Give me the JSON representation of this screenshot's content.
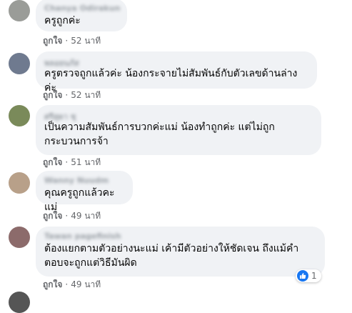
{
  "comments": [
    {
      "author": "Chanya Odirakun",
      "text": "ครูถูกค่ะ",
      "like_label": "ถูกใจ",
      "time": "52 นาที",
      "avatar_color": "#9a9c98"
    },
    {
      "author": "พลอยนภัส",
      "text": "ครูตรวจถูกแล้วค่ะ น้องกระจายไม่สัมพันธ์กับตัวเลขด้านล่างค่ะ",
      "like_label": "ถูกใจ",
      "time": "52 นาที",
      "avatar_color": "#6f7a8f"
    },
    {
      "author": "ศรีสุดา ชุ",
      "text": "เป็นความสัมพันธ์การบวกค่ะแม่ น้องทำถูกค่ะ แต่ไม่ถูก\nกระบวนการจ้า",
      "like_label": "ถูกใจ",
      "time": "51 นาที",
      "avatar_color": "#7a8a5a"
    },
    {
      "author": "Wanny Nuudm",
      "text": "คุณครูถูกแล้วคะแม่",
      "like_label": "ถูกใจ",
      "time": "49 นาที",
      "avatar_color": "#b8a089"
    },
    {
      "author": "Tawan pagefinish",
      "text": "ต้องแยกตามตัวอย่างนะแม่ เค้ามีตัวอย่างให้ชัดเจน ถึงแม้คำ\nตอบจะถูกแต่วิธีมันผิด",
      "like_label": "ถูกใจ",
      "time": "49 นาที",
      "avatar_color": "#8c6b6b",
      "reaction_count": "1"
    }
  ]
}
